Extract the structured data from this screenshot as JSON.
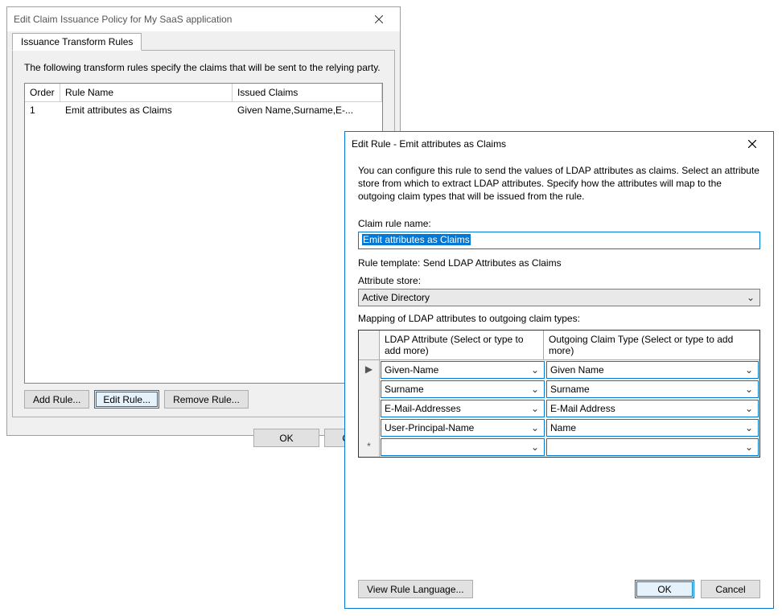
{
  "policy": {
    "title": "Edit Claim Issuance Policy for My SaaS application",
    "tab": "Issuance Transform Rules",
    "intro": "The following transform rules specify the claims that will be sent to the relying party.",
    "cols": {
      "order": "Order",
      "name": "Rule Name",
      "issued": "Issued Claims"
    },
    "rows": [
      {
        "order": "1",
        "name": "Emit attributes as Claims",
        "issued": "Given Name,Surname,E-..."
      }
    ],
    "buttons": {
      "add": "Add Rule...",
      "edit": "Edit Rule...",
      "remove": "Remove Rule...",
      "ok": "OK",
      "cancel": "Cancel"
    }
  },
  "rule": {
    "title": "Edit Rule - Emit attributes as Claims",
    "desc": "You can configure this rule to send the values of LDAP attributes as claims. Select an attribute store from which to extract LDAP attributes. Specify how the attributes will map to the outgoing claim types that will be issued from the rule.",
    "name_label": "Claim rule name:",
    "name_value": "Emit attributes as Claims",
    "template_line": "Rule template: Send LDAP Attributes as Claims",
    "store_label": "Attribute store:",
    "store_value": "Active Directory",
    "mapping_label": "Mapping of LDAP attributes to outgoing claim types:",
    "col_ldap": "LDAP Attribute (Select or type to add more)",
    "col_claim": "Outgoing Claim Type (Select or type to add more)",
    "rows": [
      {
        "marker": "▶",
        "ldap": "Given-Name",
        "claim": "Given Name"
      },
      {
        "marker": "",
        "ldap": "Surname",
        "claim": "Surname"
      },
      {
        "marker": "",
        "ldap": "E-Mail-Addresses",
        "claim": "E-Mail Address"
      },
      {
        "marker": "",
        "ldap": "User-Principal-Name",
        "claim": "Name"
      },
      {
        "marker": "*",
        "ldap": "",
        "claim": ""
      }
    ],
    "buttons": {
      "view_lang": "View Rule Language...",
      "ok": "OK",
      "cancel": "Cancel"
    }
  }
}
